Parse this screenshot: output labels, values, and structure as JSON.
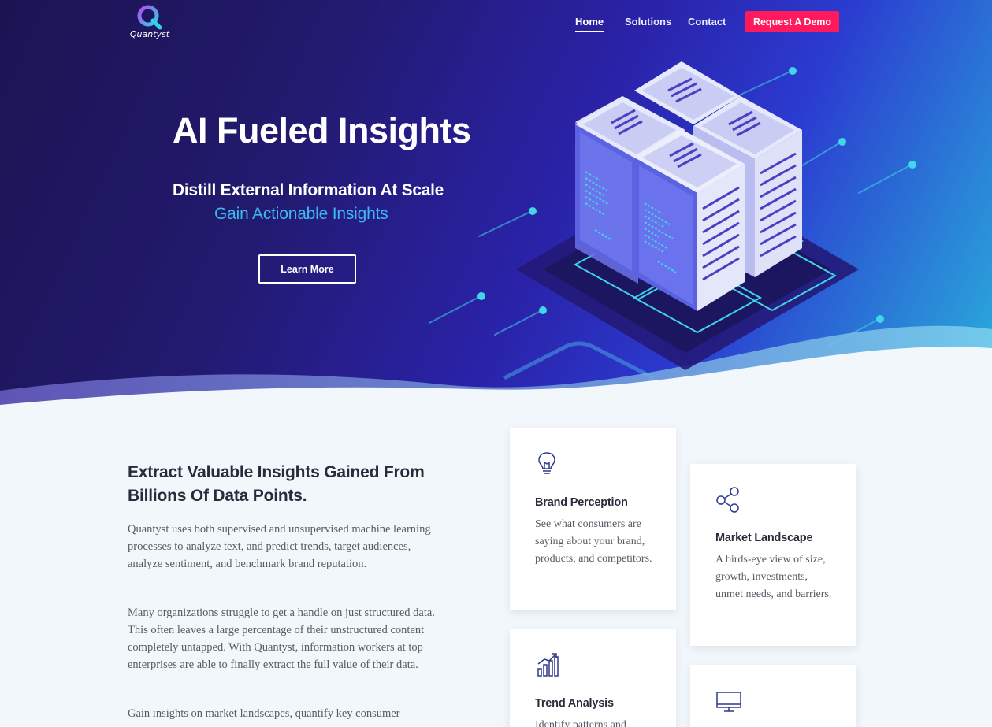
{
  "brand": {
    "name": "Quantyst"
  },
  "nav": {
    "home": "Home",
    "solutions": "Solutions",
    "contact": "Contact",
    "demo": "Request A Demo"
  },
  "hero": {
    "title": "AI Fueled Insights",
    "subtitle": "Distill External Information At Scale",
    "tagline": "Gain Actionable Insights",
    "cta": "Learn More"
  },
  "about": {
    "headline": "Extract Valuable Insights Gained From Billions Of Data Points.",
    "paragraphs": [
      "Quantyst uses both supervised and unsupervised machine learning processes to analyze text, and predict trends, target audiences, analyze sentiment, and benchmark brand reputation.",
      "Many organizations struggle to get a handle on just structured data. This often leaves a large percentage of their unstructured content completely untapped. With Quantyst, information workers at top enterprises are able to finally extract the full value of their data.",
      "Gain insights on market landscapes, quantify key consumer"
    ]
  },
  "features": [
    {
      "icon": "lightbulb-icon",
      "title": "Brand Perception",
      "description": "See what consumers are saying about your brand, products, and competitors."
    },
    {
      "icon": "share-nodes-icon",
      "title": "Market Landscape",
      "description": "A birds-eye view of size, growth, investments, unmet needs, and barriers."
    },
    {
      "icon": "bar-chart-icon",
      "title": "Trend Analysis",
      "description": "Identify patterns and"
    },
    {
      "icon": "monitor-icon",
      "title": "",
      "description": ""
    }
  ],
  "colors": {
    "hero_dark": "#1b1452",
    "hero_mid": "#2a22a8",
    "hero_light": "#2ab0dc",
    "accent_pink": "#ff1a5e",
    "tagline_blue": "#3db7f3",
    "icon_navy": "#2d3a8c",
    "page_bg": "#f2f7fb"
  }
}
